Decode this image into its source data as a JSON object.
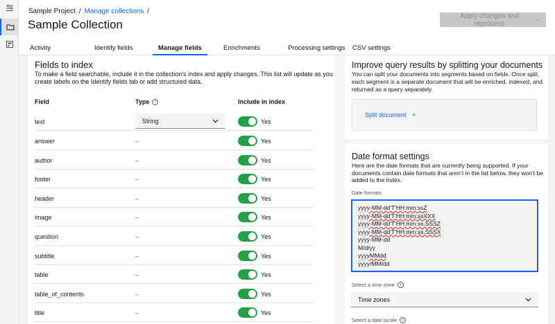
{
  "breadcrumb": {
    "project": "Sample Project",
    "separator": "/",
    "collections_link": "Manage collections"
  },
  "page_title": "Sample Collection",
  "apply_button": {
    "label": "Apply changes and reprocess",
    "arrow": "→",
    "enabled": false
  },
  "tabs": [
    {
      "label": "Activity",
      "active": false
    },
    {
      "label": "Identify fields",
      "active": false
    },
    {
      "label": "Manage fields",
      "active": true
    },
    {
      "label": "Enrichments",
      "active": false
    },
    {
      "label": "Processing settings",
      "active": false
    },
    {
      "label": "CSV settings",
      "active": false
    }
  ],
  "fields_panel": {
    "title": "Fields to index",
    "description": "To make a field searchable, include it in the collection’s index and apply changes. This list will update as you create labels on the Identify fields tab or add structured data.",
    "columns": {
      "field": "Field",
      "type": "Type",
      "index": "Include in index"
    },
    "rows": [
      {
        "field": "text",
        "type": "String",
        "include": "Yes"
      },
      {
        "field": "answer",
        "type": "–",
        "include": "Yes"
      },
      {
        "field": "author",
        "type": "–",
        "include": "Yes"
      },
      {
        "field": "footer",
        "type": "–",
        "include": "Yes"
      },
      {
        "field": "header",
        "type": "–",
        "include": "Yes"
      },
      {
        "field": "image",
        "type": "–",
        "include": "Yes"
      },
      {
        "field": "question",
        "type": "–",
        "include": "Yes"
      },
      {
        "field": "subtitle",
        "type": "–",
        "include": "Yes"
      },
      {
        "field": "table",
        "type": "–",
        "include": "Yes"
      },
      {
        "field": "table_of_contents",
        "type": "–",
        "include": "Yes"
      },
      {
        "field": "title",
        "type": "–",
        "include": "Yes"
      }
    ]
  },
  "split_panel": {
    "title": "Improve query results by splitting your documents",
    "description": "You can split your documents into segments based on fields. Once split, each segment is a separate document that will be enriched, indexed, and returned as a query separately.",
    "button": "Split document",
    "button_icon": "+"
  },
  "date_panel": {
    "title": "Date format settings",
    "description": "Here are the date formats that are currently being supported. If your documents contain date formats that aren’t in the list below, they won’t be added to the index.",
    "formats_label": "Date formats",
    "formats": [
      "yyyy-MM-dd'T'HH:mm:ssZ",
      "yyyy-MM-dd'T'HH:mm:ssXXX",
      "yyyy-MM-dd'T'HH:mm:ss.SSSZ",
      "yyyy-MM-dd'T'HH:mm:ss.SSSX",
      "yyyy-MM-dd",
      "M/d/yy",
      "yyyyMMdd",
      "yyyy/MM/dd"
    ],
    "timezone_label": "Select a time zone",
    "timezone_value": "Time zones",
    "locale_label": "Select a date locale"
  },
  "colors": {
    "accent": "#0f62fe",
    "toggle_on": "#24a148",
    "error": "#da1e28"
  }
}
